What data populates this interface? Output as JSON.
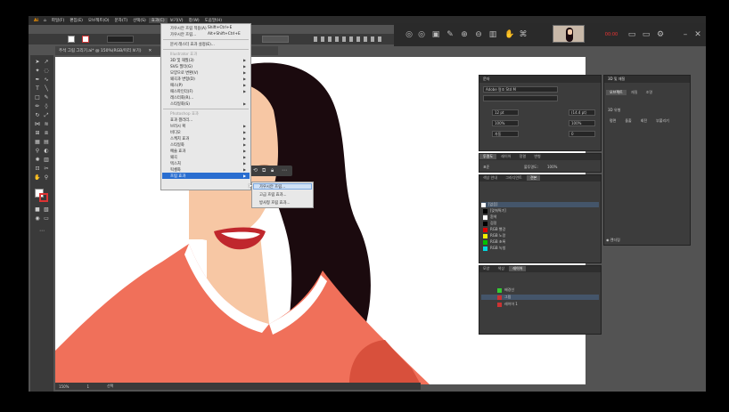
{
  "menubar": {
    "items": [
      "파일(F)",
      "편집(E)",
      "오브젝트(O)",
      "문자(T)",
      "선택(S)",
      "효과(C)",
      "보기(V)",
      "창(W)",
      "도움말(H)"
    ],
    "active_index": 5
  },
  "document_tab": {
    "label": "주석 그림 그리기.ai* @ 150%(RGB/미리 보기)"
  },
  "effects_menu": {
    "items": [
      {
        "label": "가우시안 흐림 적용(A)",
        "shortcut": "Shift+Ctrl+E"
      },
      {
        "label": "가우시안 흐림...",
        "shortcut": "Alt+Shift+Ctrl+E"
      },
      {
        "label": "문서 래스터 효과 설정(E)..."
      },
      {
        "label": "Illustrator 효과",
        "section": true
      },
      {
        "label": "3D 및 재질(3)"
      },
      {
        "label": "SVG 필터(G)"
      },
      {
        "label": "모양으로 변환(V)"
      },
      {
        "label": "왜곡과 변형(D)"
      },
      {
        "label": "패스(P)"
      },
      {
        "label": "패스파인더(F)"
      },
      {
        "label": "래스터화(R)..."
      },
      {
        "label": "스타일화(S)"
      },
      {
        "label": "Photoshop 효과",
        "section": true
      },
      {
        "label": "효과 갤러리..."
      },
      {
        "label": "브러시 획"
      },
      {
        "label": "비디오"
      },
      {
        "label": "스케치 효과"
      },
      {
        "label": "스타일화"
      },
      {
        "label": "예술 효과"
      },
      {
        "label": "왜곡"
      },
      {
        "label": "텍스처"
      },
      {
        "label": "픽셀화"
      },
      {
        "label": "흐림 효과"
      }
    ]
  },
  "blur_submenu": {
    "items": [
      "가우시안 흐림...",
      "고급 흐림 효과...",
      "방사형 흐림 효과..."
    ]
  },
  "character_panel": {
    "title": "문자",
    "font": "Adobe 명조 Std M",
    "size": "12 pt",
    "leading": "(14.4 pt)",
    "scale_v": "100%",
    "scale_h": "100%",
    "tracking": "0",
    "auto": "자동"
  },
  "appearance_panel": {
    "title": "3D 및 재질",
    "tabs": [
      "오브젝트",
      "재질",
      "조명"
    ],
    "buttons": [
      "평면",
      "돌출",
      "회전",
      "부풀리기"
    ],
    "section": "3D 유형",
    "render_label": "렌더링"
  },
  "swatches_panel": {
    "tabs": [
      "색상 안내",
      "그라디언트",
      "견본"
    ],
    "items": [
      {
        "name": "[없음]",
        "color": "#ffffff"
      },
      {
        "name": "[맞춰찍기]",
        "color": "#000000"
      },
      {
        "name": "흰색",
        "color": "#ffffff"
      },
      {
        "name": "검정",
        "color": "#000000"
      },
      {
        "name": "RGB 빨강",
        "color": "#e00000"
      },
      {
        "name": "RGB 노랑",
        "color": "#f0f000"
      },
      {
        "name": "RGB 초록",
        "color": "#00c000"
      },
      {
        "name": "RGB 녹청",
        "color": "#00d8e0"
      }
    ]
  },
  "transform_panel": {
    "tabs": [
      "투명도",
      "레이어",
      "정렬",
      "변형"
    ],
    "mode": "표준",
    "opacity_label": "불투명도:",
    "opacity": "100%"
  },
  "layers_panel": {
    "tabs": [
      "모양",
      "색상",
      "레이어"
    ],
    "layers": [
      "배경선",
      "그림",
      "레이어 1"
    ]
  },
  "status": {
    "zoom": "150%",
    "page": "1",
    "tool": "선택"
  },
  "colors": {
    "accent": "#5b9bd5",
    "kimono": "#f0705a",
    "hair": "#1b0a0e",
    "lips": "#c0272d"
  }
}
